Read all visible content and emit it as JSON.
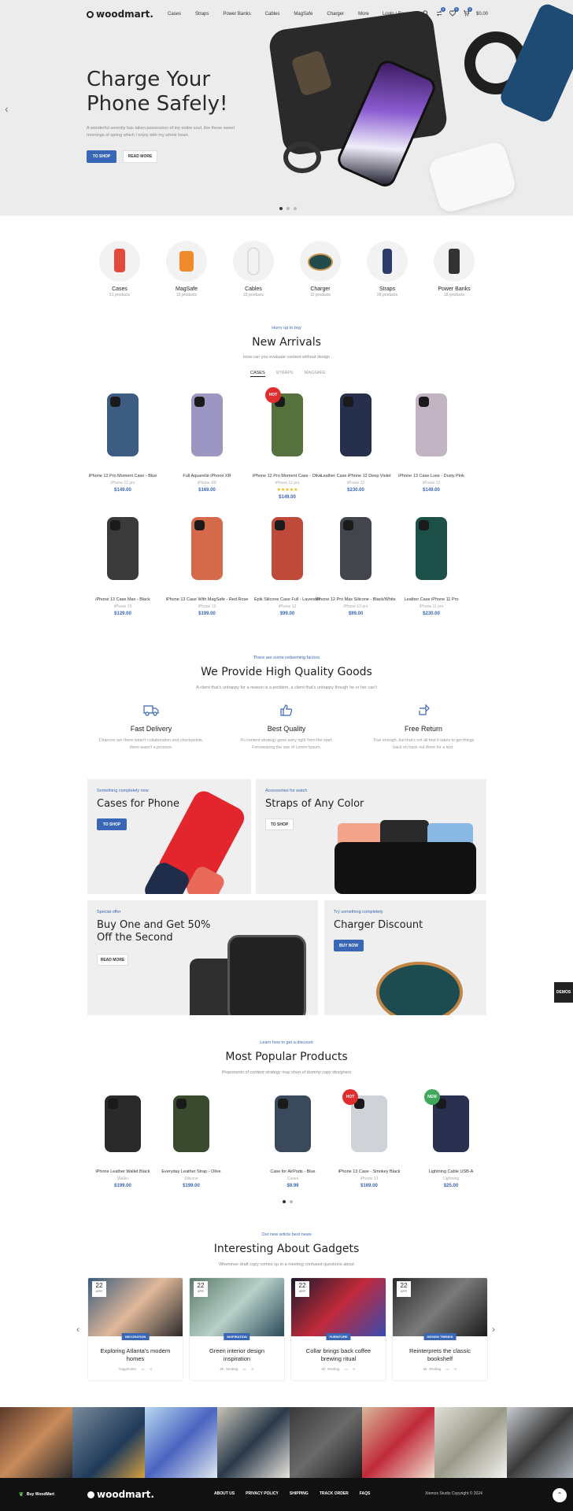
{
  "header": {
    "logo": "woodmart.",
    "nav": [
      "Cases",
      "Straps",
      "Power Banks",
      "Cables",
      "MagSafe",
      "Charger",
      "More"
    ],
    "login": "Login / Register",
    "compare_count": "0",
    "wishlist_count": "0",
    "cart_count": "0",
    "cart_total": "$0.00"
  },
  "hero": {
    "title_line1": "Charge Your",
    "title_line2": "Phone Safely!",
    "text": "A wonderful serenity has taken possession of my entire soul, like these sweet mornings of spring which I enjoy with my whole heart.",
    "btn_primary": "TO SHOP",
    "btn_secondary": "READ MORE"
  },
  "categories": [
    {
      "name": "Cases",
      "count": "31 products"
    },
    {
      "name": "MagSafe",
      "count": "15 products"
    },
    {
      "name": "Cables",
      "count": "18 products"
    },
    {
      "name": "Charger",
      "count": "12 products"
    },
    {
      "name": "Straps",
      "count": "28 products"
    },
    {
      "name": "Power Banks",
      "count": "18 products"
    }
  ],
  "arrivals": {
    "kicker": "Hurry up to buy",
    "title": "New Arrivals",
    "desc": "How can you evaluate content without design",
    "tabs": [
      "CASES",
      "STRAPS",
      "MAGSAFE"
    ],
    "products": [
      {
        "title": "iPhone 12 Pro Moment Case - Blue",
        "sub": "iPhone 12 pro",
        "price": "$149.00",
        "color": "#3c5c82"
      },
      {
        "title": "Full Aquarelle iPhone XR",
        "sub": "iPhone XR",
        "price": "$169.00",
        "color": "#9b96c2"
      },
      {
        "title": "iPhone 12 Pro Moment Case - Olive",
        "sub": "iPhone 12 pro",
        "price": "$149.00",
        "color": "#56703e",
        "hot": "HOT",
        "rating": "★★★★★"
      },
      {
        "title": "Leather Case iPhone 12 Deep Violet",
        "sub": "iPhone 12",
        "price": "$230.00",
        "color": "#26304c"
      },
      {
        "title": "iPhone 13 Case Luxe - Dusty Pink",
        "sub": "iPhone 13",
        "price": "$149.00",
        "color": "#c2b4c2"
      },
      {
        "title": "iPhone 13 Case Max - Black",
        "sub": "iPhone 13",
        "price": "$129.00",
        "color": "#3a3a3a"
      },
      {
        "title": "iPhone 13 Case With MagSafe - Red Rose",
        "sub": "iPhone 13",
        "price": "$199.00",
        "color": "#d56a4a"
      },
      {
        "title": "Epik Silicone Case Full - Lavender",
        "sub": "iPhone 12",
        "price": "$99.00",
        "color": "#c04a3a"
      },
      {
        "title": "iPhone 12 Pro Max Silicone - Black/White",
        "sub": "iPhone 13 pro",
        "price": "$99.00",
        "color": "#42464c"
      },
      {
        "title": "Leather Case iPhone 11 Pro",
        "sub": "iPhone 11 pro",
        "price": "$230.00",
        "color": "#1c5048"
      }
    ]
  },
  "quality": {
    "kicker": "There are some redeeming factors",
    "title": "We Provide High Quality Goods",
    "desc": "A client that's unhappy for a reason is a problem, a client that's unhappy though he or her can't",
    "features": [
      {
        "title": "Fast Delivery",
        "text": "Chances are there wasn't collaboration and checkpoints, there wasn't a process."
      },
      {
        "title": "Best Quality",
        "text": "It's content strategy gone awry right from the start. Forswearing the use of Lorem Ipsum."
      },
      {
        "title": "Free Return",
        "text": "True enough, but that's not all that it takes to get things back on track out there for a text."
      }
    ]
  },
  "promos": [
    {
      "sub": "Something completely new",
      "title": "Cases for Phone",
      "btn": "TO SHOP"
    },
    {
      "sub": "Accessories for watch",
      "title": "Straps of Any Color",
      "btn": "TO SHOP"
    },
    {
      "sub": "Special offer",
      "title1": "Buy One and Get 50%",
      "title2": "Off the Second",
      "btn": "READ MORE"
    },
    {
      "sub": "Try something completely",
      "title": "Charger Discount",
      "btn": "BUY NOW"
    }
  ],
  "side_tab": "DEMOS",
  "popular": {
    "kicker": "Learn how to get a discount",
    "title": "Most Popular Products",
    "desc": "Proponents of content strategy may shun of dummy copy designers",
    "products": [
      {
        "title": "iPhone Leather Wallet Black",
        "sub": "Wallet",
        "price": "$199.00"
      },
      {
        "title": "Everyday Leather Strap - Olive",
        "sub": "Silicone",
        "price": "$199.00"
      },
      {
        "title": "Case for AirPods - Blue",
        "sub": "Cases",
        "price": "$9.99"
      },
      {
        "title": "iPhone 13 Case - Smokey Black",
        "sub": "iPhone 13",
        "price": "$169.00",
        "hot": "HOT"
      },
      {
        "title": "Lightning Cable USB-A",
        "sub": "Lightning",
        "price": "$25.00",
        "new": "NEW"
      }
    ]
  },
  "blog": {
    "kicker": "Our new article best news",
    "title": "Interesting About Gadgets",
    "desc": "Whenever draft copy comes up in a meeting confused questions about",
    "posts": [
      {
        "day": "22",
        "month": "APR",
        "tag": "DECORATION",
        "title": "Exploring Atlanta's modern homes",
        "author": "Yaggmotter"
      },
      {
        "day": "22",
        "month": "APR",
        "tag": "INSPIRATION",
        "title": "Green interior design inspiration",
        "author": "Mr. Wedtag"
      },
      {
        "day": "22",
        "month": "APR",
        "tag": "FURNITURE",
        "title": "Collar brings back coffee brewing ritual",
        "author": "Mr. Wedtag"
      },
      {
        "day": "22",
        "month": "APR",
        "tag": "DESIGN TRENDS",
        "title": "Reinterprets the classic bookshelf",
        "author": "Mr. Wedtag"
      }
    ]
  },
  "footer": {
    "buy": "Buy WoodMart",
    "logo": "woodmart.",
    "links": [
      "ABOUT US",
      "PRIVACY POLICY",
      "SHIPPING",
      "TRACK ORDER",
      "FAQS"
    ],
    "copyright": "Xtemos Studio Copyright © 2024"
  }
}
